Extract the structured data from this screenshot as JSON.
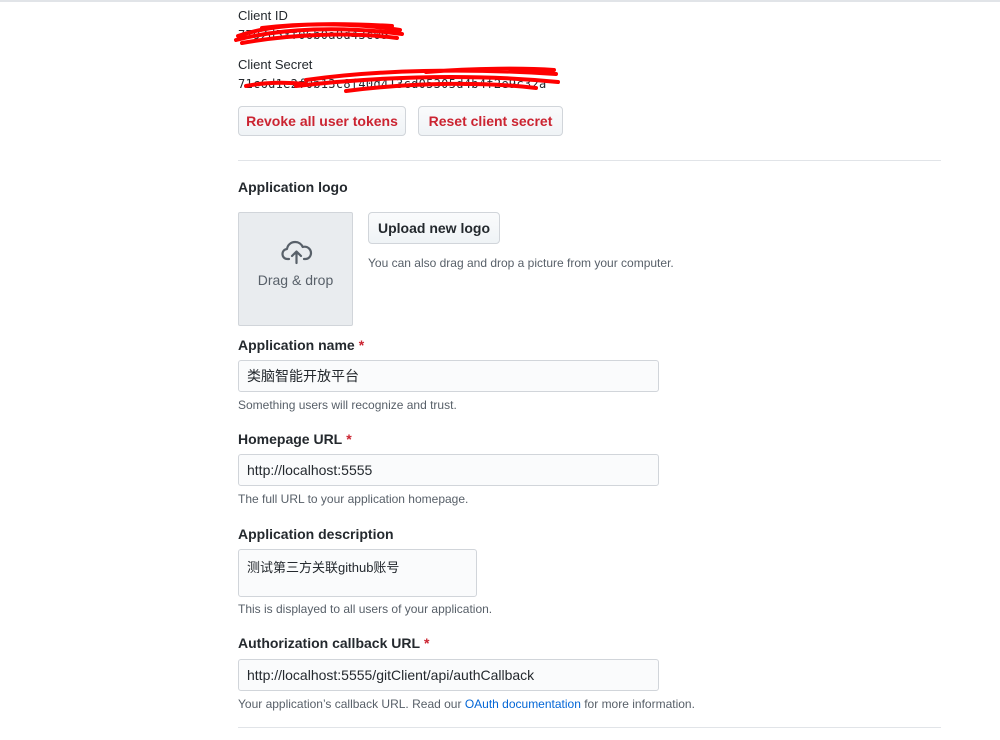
{
  "credentials": {
    "client_id_label": "Client ID",
    "client_id_value": "7792d53f06b0a8d43c09",
    "client_secret_label": "Client Secret",
    "client_secret_value": "71c6d1e2f0b13c8f40d413cd05305d4b4f2e9c32a",
    "redaction_color": "#ff0000"
  },
  "actions": {
    "revoke_label": "Revoke all user tokens",
    "reset_label": "Reset client secret"
  },
  "logo": {
    "heading": "Application logo",
    "dropzone_text": "Drag & drop",
    "dropzone_icon": "cloud-upload-icon",
    "upload_button": "Upload new logo",
    "hint": "You can also drag and drop a picture from your computer."
  },
  "form": {
    "required_marker": "*",
    "app_name": {
      "label": "Application name",
      "value": "类脑智能开放平台",
      "help": "Something users will recognize and trust."
    },
    "homepage": {
      "label": "Homepage URL",
      "value": "http://localhost:5555",
      "help": "The full URL to your application homepage."
    },
    "description": {
      "label": "Application description",
      "value": "测试第三方关联github账号",
      "help": "This is displayed to all users of your application."
    },
    "callback": {
      "label": "Authorization callback URL",
      "value": "http://localhost:5555/gitClient/api/authCallback",
      "help_prefix": "Your application’s callback URL. Read our ",
      "help_link": "OAuth documentation",
      "help_suffix": " for more information."
    }
  },
  "colors": {
    "danger": "#cb2431",
    "link": "#0366d6",
    "muted": "#586069"
  }
}
